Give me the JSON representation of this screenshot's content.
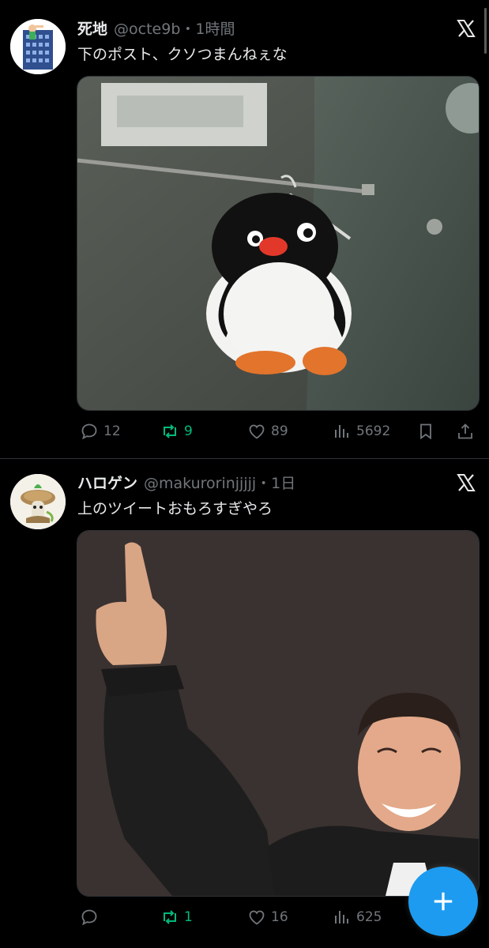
{
  "posts": [
    {
      "display_name": "死地",
      "handle_time": "@octe9b・1時間",
      "text": "下のポスト、クソつまんねぇな",
      "media_description": "penguin-plush-hanging-photo",
      "actions": {
        "reply_count": "12",
        "retweet_count": "9",
        "like_count": "89",
        "view_count": "5692"
      }
    },
    {
      "display_name": "ハロゲン",
      "handle_time": "@makurorinjjjjj・1日",
      "text": "上のツイートおもろすぎやろ",
      "media_description": "man-pointing-up-photo",
      "actions": {
        "reply_count": "",
        "retweet_count": "1",
        "like_count": "16",
        "view_count": "625"
      }
    }
  ],
  "colors": {
    "background": "#000000",
    "text_primary": "#e7e9ea",
    "text_secondary": "#71767b",
    "retweet_active": "#00ba7c",
    "accent": "#1d9bf0",
    "divider": "#2f3336"
  },
  "icons": {
    "logo": "x-logo-icon",
    "reply": "reply-icon",
    "retweet": "retweet-icon",
    "like": "like-icon",
    "views": "views-icon",
    "bookmark": "bookmark-icon",
    "share": "share-icon",
    "compose": "plus-icon"
  }
}
